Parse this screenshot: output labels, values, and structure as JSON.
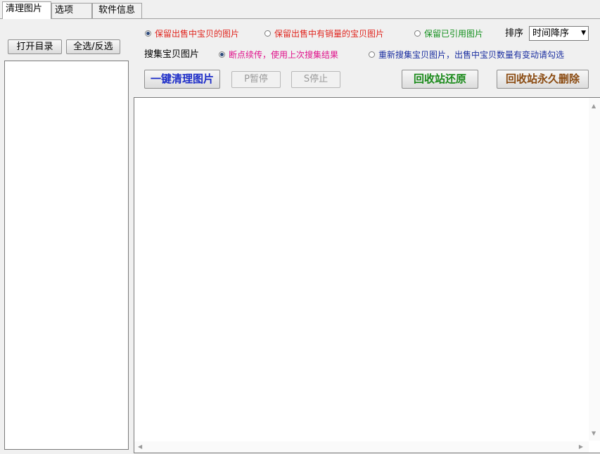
{
  "tabs": [
    {
      "label": "清理图片",
      "active": true
    },
    {
      "label": "选项",
      "active": false
    },
    {
      "label": "软件信息",
      "active": false
    }
  ],
  "left": {
    "open_dir_label": "打开目录",
    "select_all_label": "全选/反选"
  },
  "options": {
    "keep_row": [
      {
        "label": "保留出售中宝贝的图片",
        "checked": true,
        "color": "#e0261f"
      },
      {
        "label": "保留出售中有销量的宝贝图片",
        "checked": false,
        "color": "#e0261f"
      },
      {
        "label": "保留已引用图片",
        "checked": false,
        "color": "#14901e"
      }
    ],
    "sort_label": "排序",
    "sort_value": "时间降序",
    "collect_label": "搜集宝贝图片",
    "collect_row": [
      {
        "label": "断点续传，使用上次搜集结果",
        "checked": true,
        "color": "#e0148c"
      },
      {
        "label": "重新搜集宝贝图片，出售中宝贝数量有变动请勾选",
        "checked": false,
        "color": "#1a2ea0"
      }
    ]
  },
  "actions": {
    "clean_label": "一键清理图片",
    "clean_color": "#1c2cc8",
    "pause_label": "P暂停",
    "stop_label": "S停止",
    "restore_label": "回收站还原",
    "restore_color": "#1a8a1a",
    "delete_label": "回收站永久删除",
    "delete_color": "#8a4a10"
  }
}
